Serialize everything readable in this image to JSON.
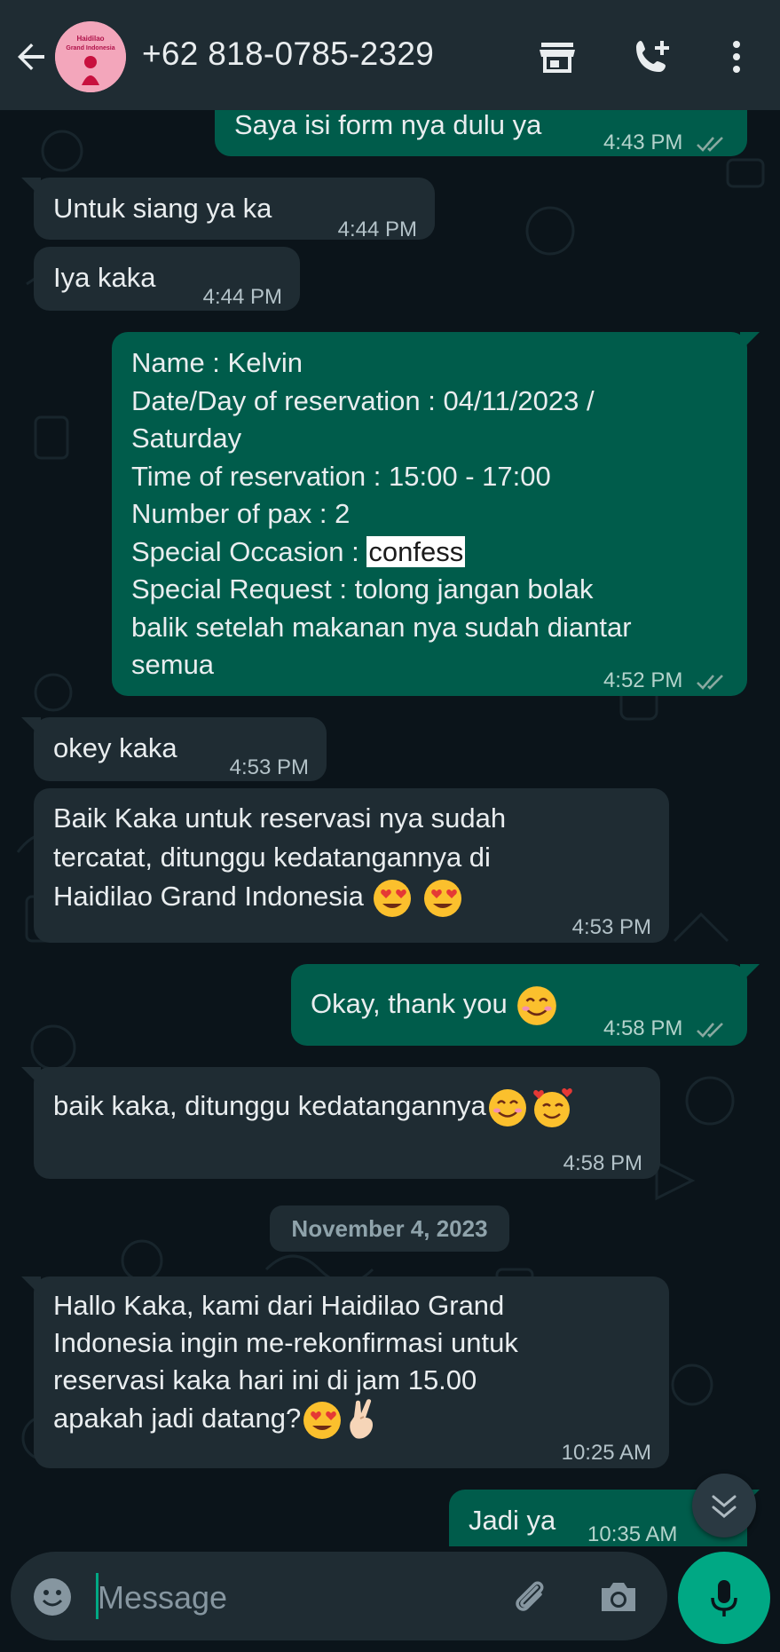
{
  "header": {
    "contact": "+62 818-0785-2329",
    "avatar_text_top": "Haidilao",
    "avatar_text_bottom": "Grand Indonesia"
  },
  "messages": [
    {
      "dir": "out",
      "text": "Saya isi form nya dulu ya",
      "time": "4:43 PM"
    },
    {
      "dir": "in",
      "text": "Untuk siang ya ka",
      "time": "4:44 PM"
    },
    {
      "dir": "in",
      "text": "Iya kaka",
      "time": "4:44 PM"
    },
    {
      "dir": "out",
      "lines": [
        "Name : Kelvin",
        "Date/Day of reservation  : 04/11/2023 /",
        "Saturday",
        "Time of reservation : 15:00 - 17:00",
        "Number of pax : 2",
        "Special Occasion : ",
        "Special Request : tolong jangan bolak",
        "balik setelah makanan nya sudah diantar",
        "semua"
      ],
      "highlight": "confess",
      "time": "4:52 PM"
    },
    {
      "dir": "in",
      "text": "okey kaka",
      "time": "4:53 PM"
    },
    {
      "dir": "in",
      "lines": [
        "Baik Kaka untuk reservasi nya sudah",
        "tercatat, ditunggu kedatangannya di",
        "Haidilao Grand Indonesia"
      ],
      "time": "4:53 PM"
    },
    {
      "dir": "out",
      "text": "Okay, thank you",
      "time": "4:58 PM"
    },
    {
      "dir": "in",
      "text": "baik kaka, ditunggu kedatangannya",
      "time": "4:58 PM"
    },
    {
      "dir": "in",
      "lines": [
        "Hallo Kaka, kami dari Haidilao Grand",
        "Indonesia ingin me-rekonfirmasi untuk",
        "reservasi kaka hari ini di jam 15.00",
        "apakah jadi datang?"
      ],
      "time": "10:25 AM"
    },
    {
      "dir": "out",
      "text": "Jadi ya",
      "time": "10:35 AM"
    }
  ],
  "date_chip": "November 4, 2023",
  "composer": {
    "placeholder": "Message"
  },
  "colors": {
    "bg": "#0b141a",
    "header": "#1f2c33",
    "incoming": "#1f2c33",
    "outgoing": "#005c4b",
    "accent": "#00a884"
  },
  "icons": [
    "back-arrow-icon",
    "shop-icon",
    "add-call-icon",
    "more-vert-icon",
    "emoji-icon",
    "attach-icon",
    "camera-icon",
    "mic-icon",
    "double-check-icon",
    "chevron-down-icon"
  ]
}
